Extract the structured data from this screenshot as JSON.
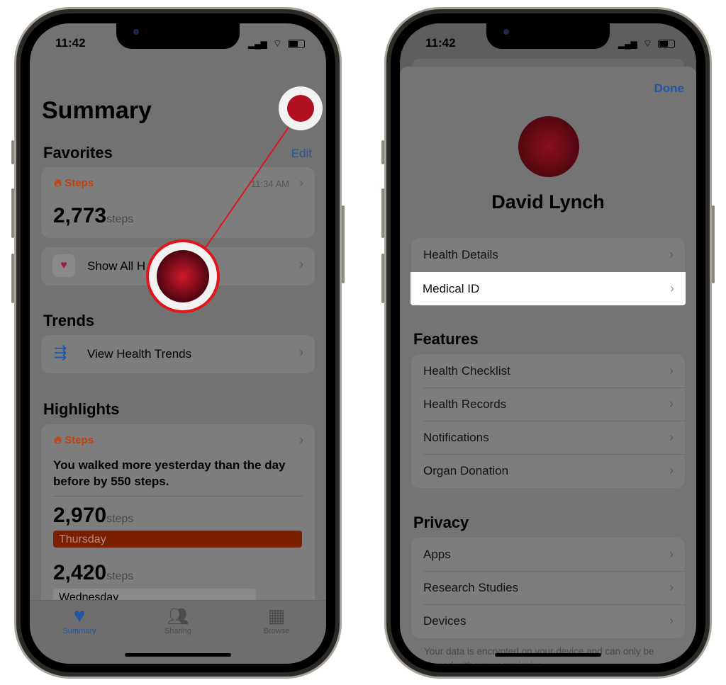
{
  "left": {
    "status_time": "11:42",
    "title": "Summary",
    "favorites": {
      "heading": "Favorites",
      "edit_label": "Edit",
      "steps_card": {
        "label": "Steps",
        "time": "11:34 AM",
        "value": "2,773",
        "unit": "steps"
      },
      "show_all_label": "Show All H"
    },
    "trends": {
      "heading": "Trends",
      "item_label": "View Health Trends"
    },
    "highlights": {
      "heading": "Highlights",
      "label": "Steps",
      "text": "You walked more yesterday than the day before by 550 steps.",
      "bars": [
        {
          "value": "2,970",
          "unit": "steps",
          "day": "Thursday",
          "fill": 1.0
        },
        {
          "value": "2,420",
          "unit": "steps",
          "day": "Wednesday",
          "fill": 0.815
        }
      ]
    },
    "tabs": [
      {
        "label": "Summary",
        "icon": "heart-icon",
        "active": true
      },
      {
        "label": "Sharing",
        "icon": "people-icon"
      },
      {
        "label": "Browse",
        "icon": "grid-icon"
      }
    ]
  },
  "right": {
    "status_time": "11:42",
    "done_label": "Done",
    "profile_name": "David Lynch",
    "profile_items": [
      "Health Details",
      "Medical ID"
    ],
    "features": {
      "heading": "Features",
      "items": [
        "Health Checklist",
        "Health Records",
        "Notifications",
        "Organ Donation"
      ]
    },
    "privacy": {
      "heading": "Privacy",
      "items": [
        "Apps",
        "Research Studies",
        "Devices"
      ],
      "footer": "Your data is encrypted on your device and can only be shared with your permission."
    }
  },
  "colors": {
    "accent": "#1f56a8",
    "steps_orange": "#c2410c",
    "bar_thursday": "#7a2000",
    "annotation_red": "#e0161c",
    "highlight": "#ffffff"
  }
}
